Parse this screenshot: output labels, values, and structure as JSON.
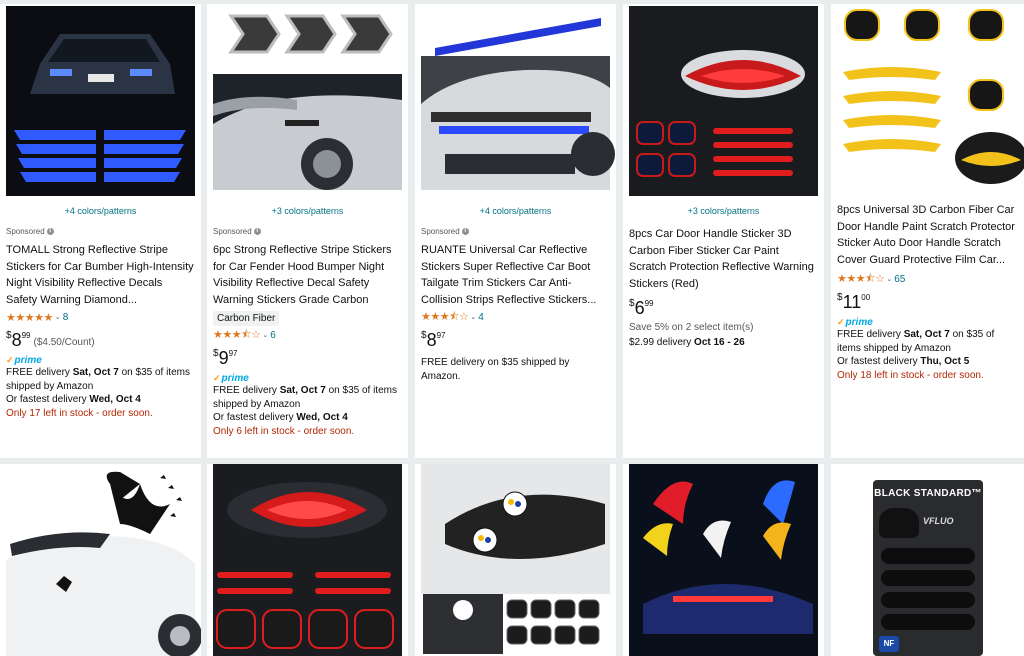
{
  "colors_theme": {
    "link": "#007185",
    "star": "#de7921",
    "price": "#0f1111",
    "stock": "#b12704",
    "prime": "#00a8e1"
  },
  "sponsored_label": "Sponsored",
  "products": [
    {
      "colors_link": "+4 colors/patterns",
      "sponsored": true,
      "title": "TOMALL Strong Reflective Stripe Stickers for Car Bumber High-Intensity Night Visibility Reflective Decals Safety Warning Diamond...",
      "stars": "★★★★★",
      "rating_count": "8",
      "price": {
        "currency": "$",
        "whole": "8",
        "fraction": "99",
        "unit": "($4.50/Count)"
      },
      "prime": "prime",
      "delivery": {
        "prefix": "FREE delivery ",
        "date": "Sat, Oct 7",
        "suffix": " on $35 of items shipped by Amazon"
      },
      "fastest": {
        "prefix": "Or fastest delivery ",
        "date": "Wed, Oct 4"
      },
      "stock": "Only 17 left in stock - order soon."
    },
    {
      "colors_link": "+3 colors/patterns",
      "sponsored": true,
      "title": "6pc Strong Reflective Stripe Stickers for Car Fender Hood Bumper Night Visibility Reflective Decal Safety Warning Stickers Grade Carbon Fibe...",
      "badge": "Carbon Fiber",
      "stars": "★★★⯪☆",
      "rating_count": "6",
      "price": {
        "currency": "$",
        "whole": "9",
        "fraction": "97"
      },
      "prime": "prime",
      "delivery": {
        "prefix": "FREE delivery ",
        "date": "Sat, Oct 7",
        "suffix": " on $35 of items shipped by Amazon"
      },
      "fastest": {
        "prefix": "Or fastest delivery ",
        "date": "Wed, Oct 4"
      },
      "stock": "Only 6 left in stock - order soon."
    },
    {
      "colors_link": "+4 colors/patterns",
      "sponsored": true,
      "title": "RUANTE Universal Car Reflective Stickers Super Reflective Car Boot Tailgate Trim Stickers Car Anti-Collision Strips Reflective Stickers...",
      "stars": "★★★⯪☆",
      "rating_count": "4",
      "price": {
        "currency": "$",
        "whole": "8",
        "fraction": "97"
      },
      "delivery_plain": "FREE delivery on $35 shipped by Amazon."
    },
    {
      "colors_link": "+3 colors/patterns",
      "title": "8pcs Car Door Handle Sticker 3D Carbon Fiber Sticker Car Paint Scratch Protection Reflective Warning Stickers (Red)",
      "price": {
        "currency": "$",
        "whole": "6",
        "fraction": "99"
      },
      "save": "Save 5% on 2 select item(s)",
      "delivery_fee": {
        "prefix": "$2.99 delivery ",
        "date": "Oct 16 - 26"
      }
    },
    {
      "title": "8pcs Universal 3D Carbon Fiber Car Door Handle Paint Scratch Protector Sticker Auto Door Handle Scratch Cover Guard Protective Film Car...",
      "stars": "★★★⯪☆",
      "rating_count": "65",
      "price": {
        "currency": "$",
        "whole": "11",
        "fraction": "00"
      },
      "prime": "prime",
      "delivery": {
        "prefix": "FREE delivery ",
        "date": "Sat, Oct 7",
        "suffix": " on $35 of items shipped by Amazon"
      },
      "fastest": {
        "prefix": "Or fastest delivery ",
        "date": "Thu, Oct 5"
      },
      "stock": "Only 18 left in stock - order soon."
    }
  ],
  "row2": {
    "item5_brand": "BLACK STANDARD™",
    "item5_logo": "VFLUO",
    "item5_badge": "NF"
  }
}
